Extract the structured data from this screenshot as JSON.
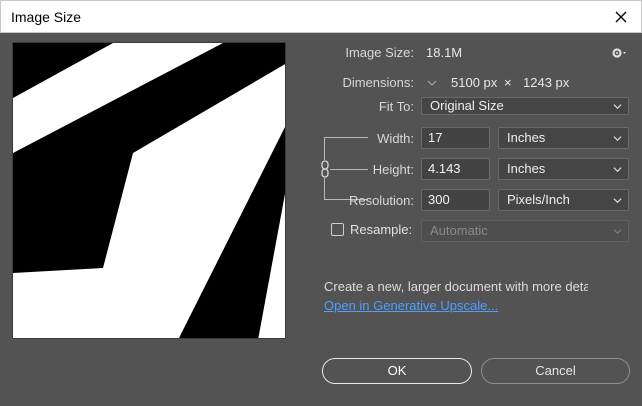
{
  "window": {
    "title": "Image Size"
  },
  "info": {
    "image_size_label": "Image Size:",
    "image_size_value": "18.1M",
    "dimensions_label": "Dimensions:",
    "dimensions_width": "5100 px",
    "dimensions_x": "×",
    "dimensions_height": "1243 px"
  },
  "fit_to": {
    "label": "Fit To:",
    "value": "Original Size"
  },
  "width": {
    "label": "Width:",
    "value": "17",
    "unit": "Inches"
  },
  "height": {
    "label": "Height:",
    "value": "4.143",
    "unit": "Inches"
  },
  "resolution": {
    "label": "Resolution:",
    "value": "300",
    "unit": "Pixels/Inch"
  },
  "resample": {
    "label": "Resample:",
    "checked": false,
    "value": "Automatic"
  },
  "upscale": {
    "description": "Create a new, larger document with more detai",
    "link": "Open in Generative Upscale..."
  },
  "buttons": {
    "ok": "OK",
    "cancel": "Cancel"
  },
  "colors": {
    "dialog_bg": "#535353",
    "link": "#4ea0ff"
  }
}
